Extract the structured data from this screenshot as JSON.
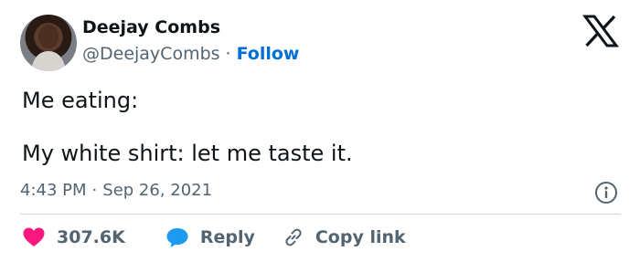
{
  "author": {
    "display_name": "Deejay Combs",
    "handle": "@DeejayCombs",
    "separator": "·",
    "follow_label": "Follow"
  },
  "tweet": {
    "text": "Me eating:\n\nMy white shirt: let me taste it.",
    "time": "4:43 PM",
    "separator": "·",
    "date": "Sep 26, 2021"
  },
  "actions": {
    "like_count": "307.6K",
    "reply_label": "Reply",
    "copy_link_label": "Copy link"
  },
  "colors": {
    "link_blue": "#006fd6",
    "heart_pink": "#f91880",
    "reply_blue": "#1d9bf0",
    "secondary_text": "#536471"
  },
  "icons": [
    "x-logo-icon",
    "info-icon",
    "heart-icon",
    "reply-bubble-icon",
    "link-icon"
  ]
}
